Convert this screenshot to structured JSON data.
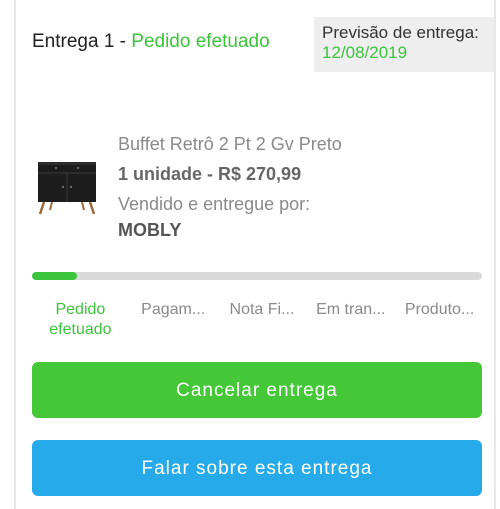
{
  "delivery": {
    "title_prefix": "Entrega 1 - ",
    "status": "Pedido efetuado",
    "forecast_label": "Previsão de entrega:",
    "forecast_date": "12/08/2019"
  },
  "product": {
    "image_icon": "dresser-image",
    "name": "Buffet Retrô 2 Pt 2 Gv Preto",
    "quantity_price": "1 unidade - R$ 270,99",
    "seller_label": "Vendido e entregue por:",
    "seller": "MOBLY"
  },
  "progress": {
    "fraction": 0.1,
    "color": "#3cc43c",
    "steps": [
      {
        "label": "Pedido efetuado",
        "active": true
      },
      {
        "label": "Pagam..."
      },
      {
        "label": "Nota Fi..."
      },
      {
        "label": "Em tran..."
      },
      {
        "label": "Produto..."
      }
    ]
  },
  "actions": {
    "cancel_label": "Cancelar entrega",
    "cancel_color": "#44c838",
    "talk_label": "Falar sobre esta entrega",
    "talk_color": "#27aaea"
  }
}
